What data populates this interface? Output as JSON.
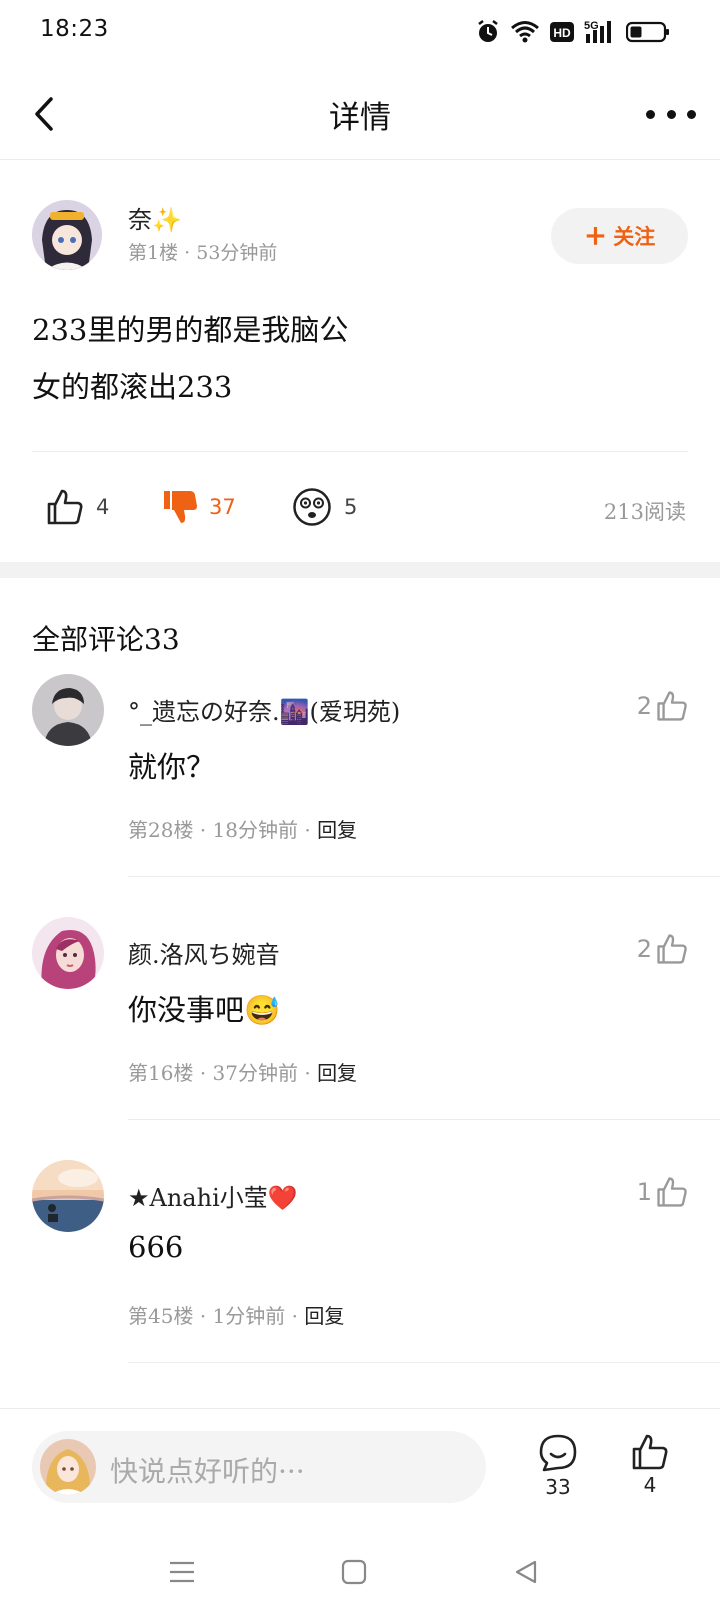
{
  "status_bar": {
    "time": "18:23",
    "hd_label": "HD",
    "network_label": "5G"
  },
  "header": {
    "title": "详情"
  },
  "post": {
    "author": "奈✨",
    "floor": "第1楼",
    "time": "53分钟前",
    "follow_label": "关注",
    "follow_plus": "+",
    "content_lines": [
      "233里的男的都是我脑公",
      "女的都滚出233"
    ],
    "likes": "4",
    "dislikes": "37",
    "shocked": "5",
    "reads": "213阅读"
  },
  "comments_header": "全部评论33",
  "comments": [
    {
      "name": "°_遗忘の好奈.🌆(爱玥苑)",
      "text": "就你？",
      "floor": "第28楼",
      "time": "18分钟前",
      "reply": "回复",
      "likes": "2"
    },
    {
      "name": "颜.洛风ち婉音",
      "text": "你没事吧😅",
      "floor": "第16楼",
      "time": "37分钟前",
      "reply": "回复",
      "likes": "2"
    },
    {
      "name": "★Anahi小莹❤️",
      "text": "666",
      "floor": "第45楼",
      "time": "1分钟前",
      "reply": "回复",
      "likes": "1"
    }
  ],
  "bottom_bar": {
    "placeholder": "快说点好听的···",
    "comment_count": "33",
    "like_count": "4"
  },
  "separator": "·",
  "colors": {
    "accent": "#ef6113",
    "muted": "#999999",
    "divider": "#ececec",
    "section_gap": "#f2f2f2"
  },
  "icons": [
    "alarm-icon",
    "wifi-icon",
    "hd-icon",
    "signal-icon",
    "battery-icon",
    "back-arrow-icon",
    "more-icon",
    "thumbs-up-icon",
    "thumbs-down-icon",
    "shocked-face-icon",
    "comment-bubble-icon",
    "menu-icon",
    "home-square-icon",
    "back-triangle-icon"
  ]
}
